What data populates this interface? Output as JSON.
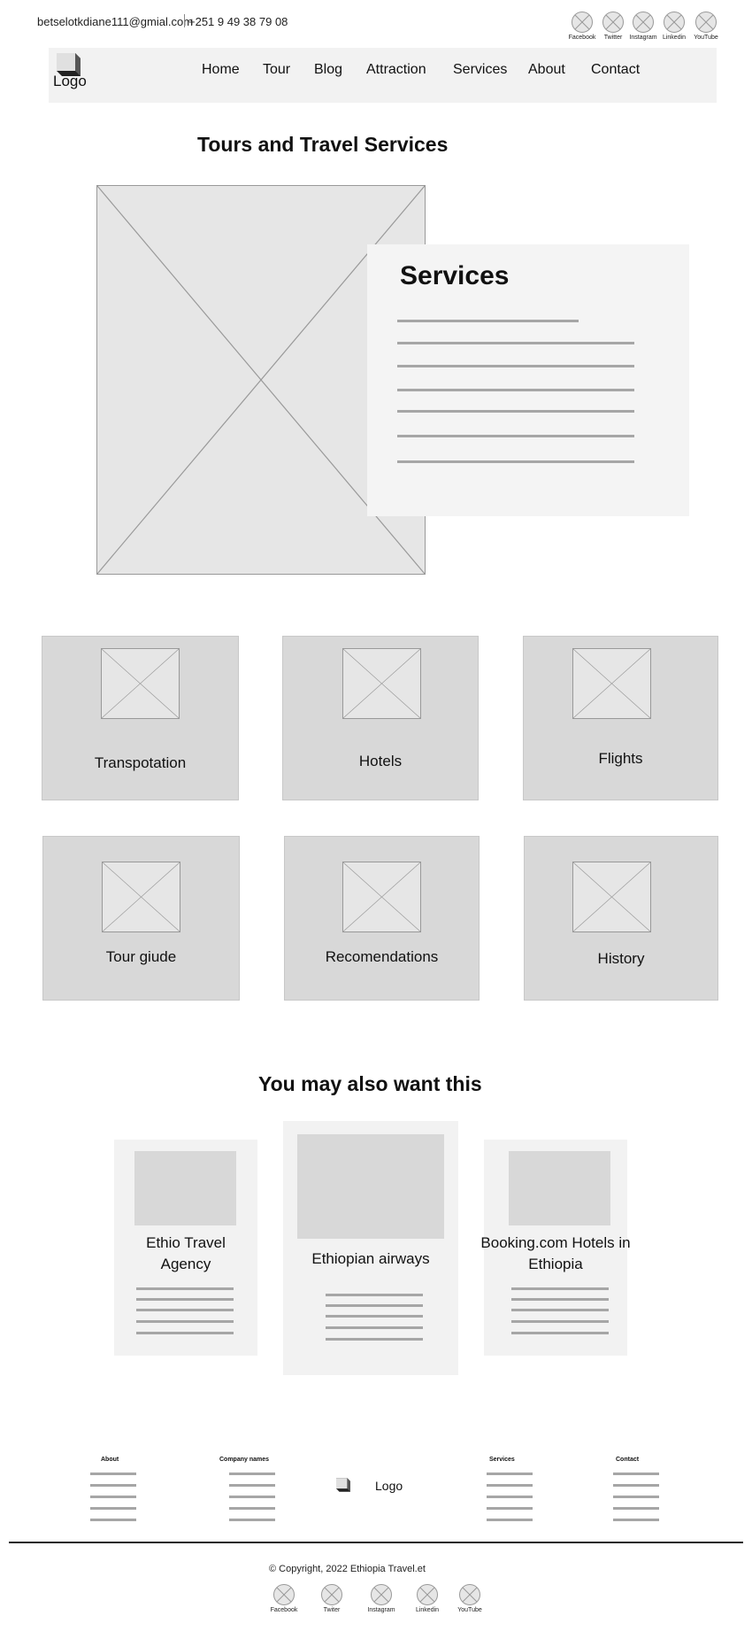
{
  "topbar": {
    "email": "betselotkdiane111@gmial.com",
    "phone": "+251 9 49 38 79 08",
    "socials": [
      {
        "label": "Facebook",
        "icon": "facebook-icon"
      },
      {
        "label": "Twitter",
        "icon": "twitter-icon"
      },
      {
        "label": "Instagram",
        "icon": "instagram-icon"
      },
      {
        "label": "Linkedin",
        "icon": "linkedin-icon"
      },
      {
        "label": "YouTube",
        "icon": "youtube-icon"
      }
    ]
  },
  "nav": {
    "logo": "Logo",
    "items": [
      "Home",
      "Tour",
      "Blog",
      "Attraction",
      "Services",
      "About",
      "Contact"
    ]
  },
  "hero": {
    "title": "Tours and Travel Services",
    "panel_title": "Services"
  },
  "service_tiles": [
    {
      "label": "Transpotation"
    },
    {
      "label": "Hotels"
    },
    {
      "label": "Flights"
    },
    {
      "label": "Tour giude"
    },
    {
      "label": "Recomendations"
    },
    {
      "label": "History"
    }
  ],
  "suggestions": {
    "title": "You may also want this",
    "cards": [
      {
        "title": "Ethio Travel Agency"
      },
      {
        "title": "Ethiopian airways"
      },
      {
        "title": "Booking.com Hotels in Ethiopia"
      }
    ]
  },
  "footer": {
    "columns": [
      "About",
      "Company names",
      "Services",
      "Contact"
    ],
    "logo": "Logo",
    "copyright": "© Copyright, 2022 Ethiopia Travel.et",
    "socials": [
      {
        "label": "Facebook",
        "icon": "facebook-icon"
      },
      {
        "label": "Twiter",
        "icon": "twitter-icon"
      },
      {
        "label": "Instagram",
        "icon": "instagram-icon"
      },
      {
        "label": "Linkedin",
        "icon": "linkedin-icon"
      },
      {
        "label": "YouTube",
        "icon": "youtube-icon"
      }
    ]
  }
}
